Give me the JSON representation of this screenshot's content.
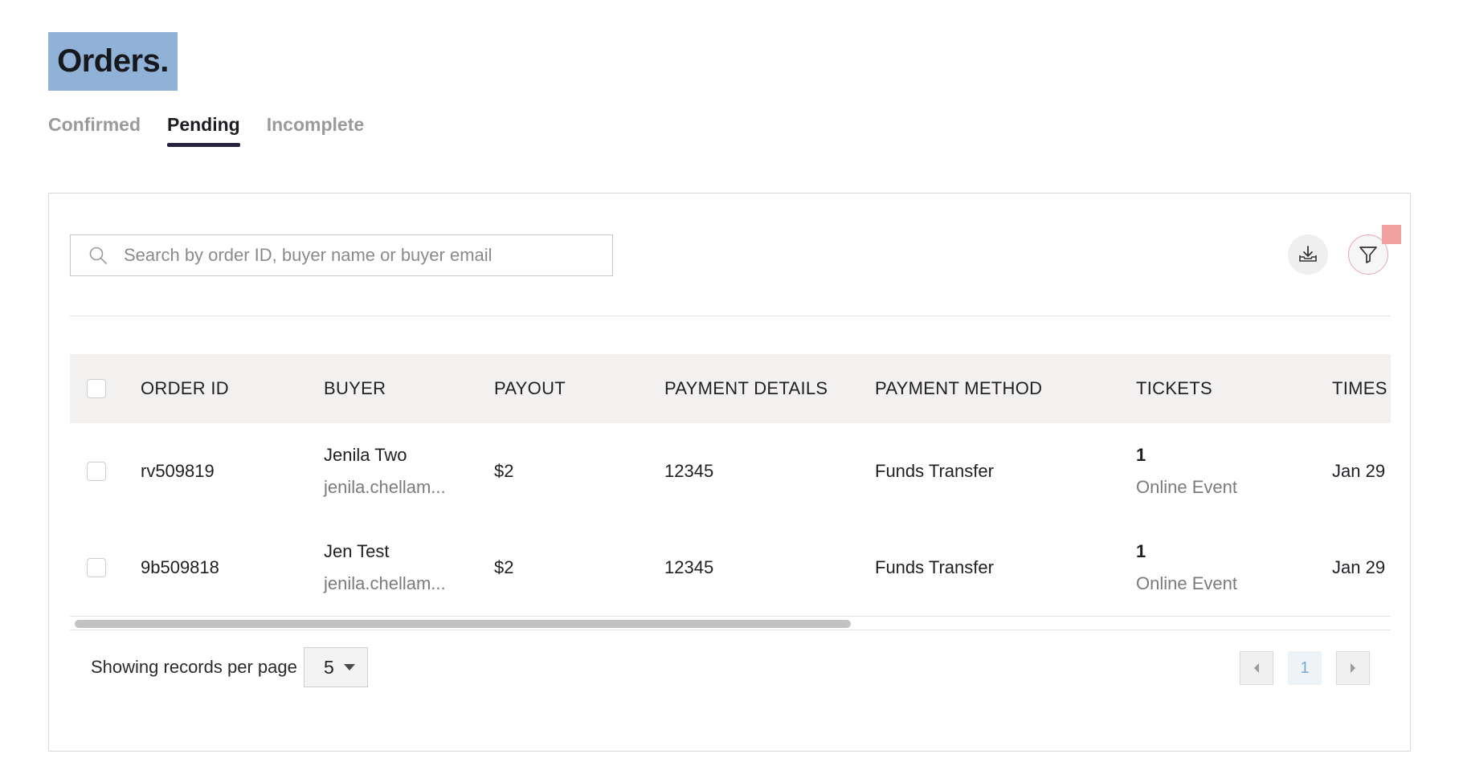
{
  "page": {
    "title": "Orders."
  },
  "tabs": [
    {
      "label": "Confirmed",
      "active": false
    },
    {
      "label": "Pending",
      "active": true
    },
    {
      "label": "Incomplete",
      "active": false
    }
  ],
  "search": {
    "placeholder": "Search by order ID, buyer name or buyer email",
    "value": ""
  },
  "toolbar": {
    "download_icon": "download-tray-icon",
    "filter_icon": "funnel-icon"
  },
  "table": {
    "columns": [
      "ORDER ID",
      "BUYER",
      "PAYOUT",
      "PAYMENT DETAILS",
      "PAYMENT METHOD",
      "TICKETS",
      "TIMES"
    ],
    "rows": [
      {
        "order_id": "rv509819",
        "buyer_name": "Jenila Two",
        "buyer_email": "jenila.chellam...",
        "payout": "$2",
        "payment_details": "12345",
        "payment_method": "Funds Transfer",
        "tickets": "1",
        "ticket_type": "Online Event",
        "timestamp": "Jan 29"
      },
      {
        "order_id": "9b509818",
        "buyer_name": "Jen Test",
        "buyer_email": "jenila.chellam...",
        "payout": "$2",
        "payment_details": "12345",
        "payment_method": "Funds Transfer",
        "tickets": "1",
        "ticket_type": "Online Event",
        "timestamp": "Jan 29"
      }
    ]
  },
  "footer": {
    "records_label": "Showing records per page",
    "page_size": "5",
    "current_page": "1"
  },
  "colors": {
    "title_bg": "#8fb2d6",
    "active_tab_underline": "#25233d",
    "header_bg": "#f2f1ef",
    "filter_badge": "#f3a0a0"
  }
}
